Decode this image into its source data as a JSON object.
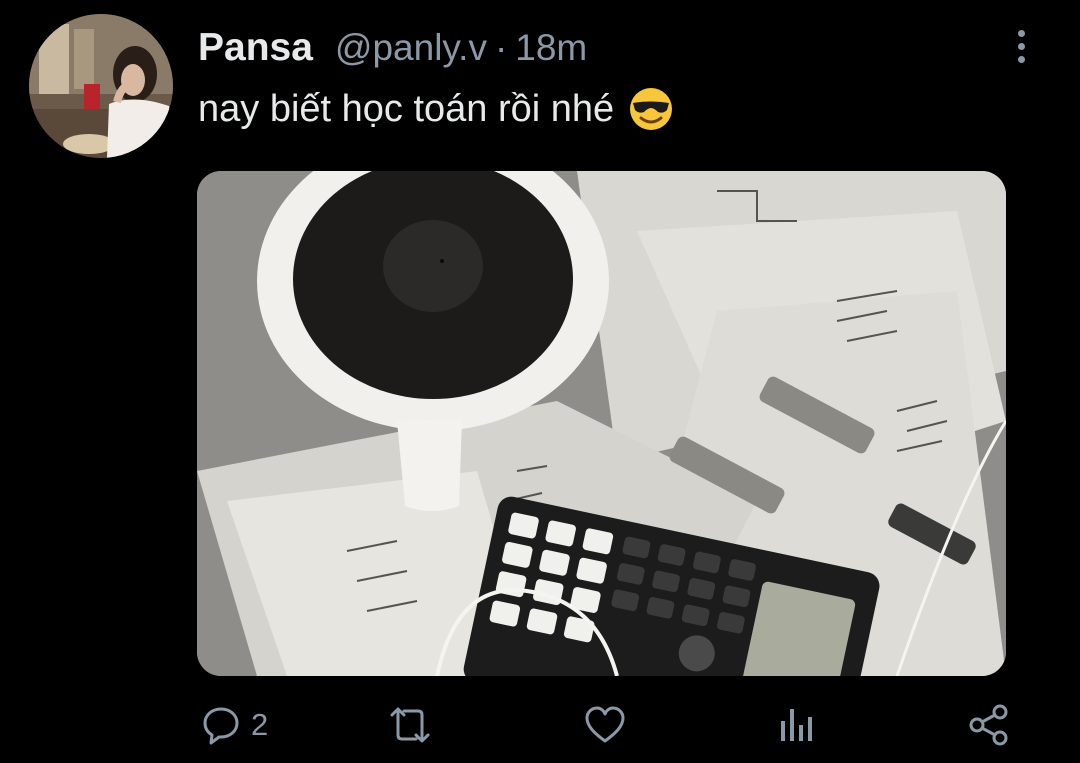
{
  "tweet": {
    "author_name": "Pansa",
    "handle": "@panly.v",
    "separator": "·",
    "time": "18m",
    "text": "nay biết học toán rồi nhé",
    "emoji": "smiling-face-with-sunglasses-icon",
    "media_alt": "coffee-cup-calculator-math-papers-photo"
  },
  "actions": {
    "reply_count": "2",
    "retweet_count": "",
    "like_count": ""
  },
  "colors": {
    "background": "#000000",
    "text": "#e7e9ea",
    "secondary": "#8b98a5"
  }
}
